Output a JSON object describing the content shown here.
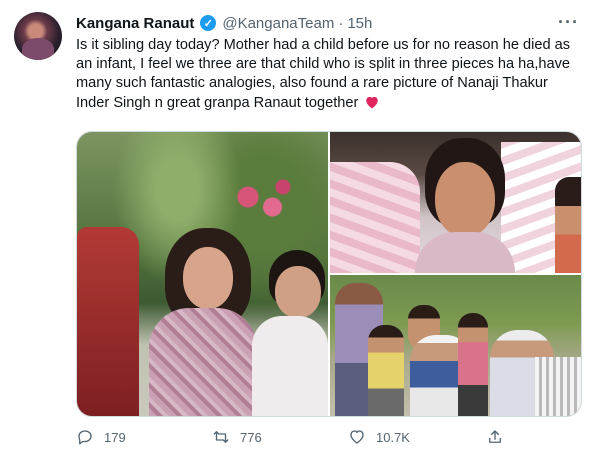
{
  "tweet": {
    "author_name": "Kangana Ranaut",
    "handle": "@KanganaTeam",
    "separator": "·",
    "time": "15h",
    "more_icon": "more-horizontal-icon",
    "verified_icon": "verified-badge-icon",
    "text": "Is it sibling day today? Mother had a child before us for no reason he died as an infant, I feel we three are that child who is split in three pieces ha ha,have many such fantastic analogies, also found a rare picture of Nanaji Thakur Inder Singh n great granpa Ranaut together",
    "emoji": "red-heart-icon"
  },
  "actions": {
    "reply_count": "179",
    "retweet_count": "776",
    "like_count": "10.7K"
  },
  "colors": {
    "verified": "#1d9bf0",
    "muted": "#536471",
    "heart": "#e0245e"
  }
}
